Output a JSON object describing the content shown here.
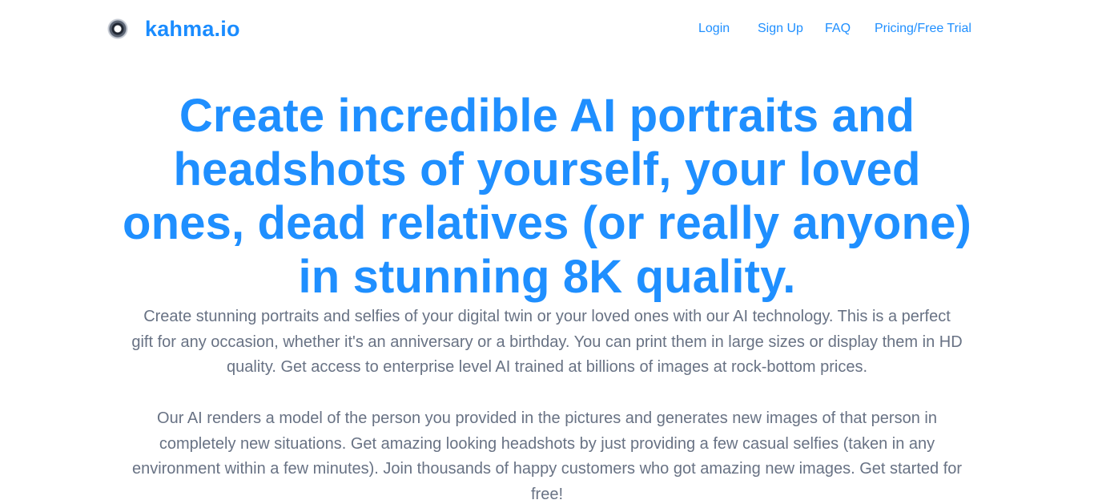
{
  "header": {
    "brand": "kahma.io",
    "logo_icon": "kahma-logo-icon",
    "nav": {
      "login": "Login",
      "signup": "Sign Up",
      "faq": "FAQ",
      "pricing": "Pricing/Free Trial"
    }
  },
  "hero": {
    "title": "Create incredible AI portraits and headshots of yourself, your loved ones, dead relatives (or really anyone) in stunning 8K quality.",
    "paragraph_1": "Create stunning portraits and selfies of your digital twin or your loved ones with our AI technology. This is a perfect gift for any occasion, whether it's an anniversary or a birthday. You can print them in large sizes or display them in HD quality. Get access to enterprise level AI trained at billions of images at rock-bottom prices.",
    "paragraph_2": "Our AI renders a model of the person you provided in the pictures and generates new images of that person in completely new situations. Get amazing looking headshots by just providing a few casual selfies (taken in any environment within a few minutes). Join thousands of happy customers who got amazing new images. Get started for free!"
  },
  "colors": {
    "accent": "#1f8fff",
    "body_text": "#687284",
    "background": "#ffffff"
  }
}
